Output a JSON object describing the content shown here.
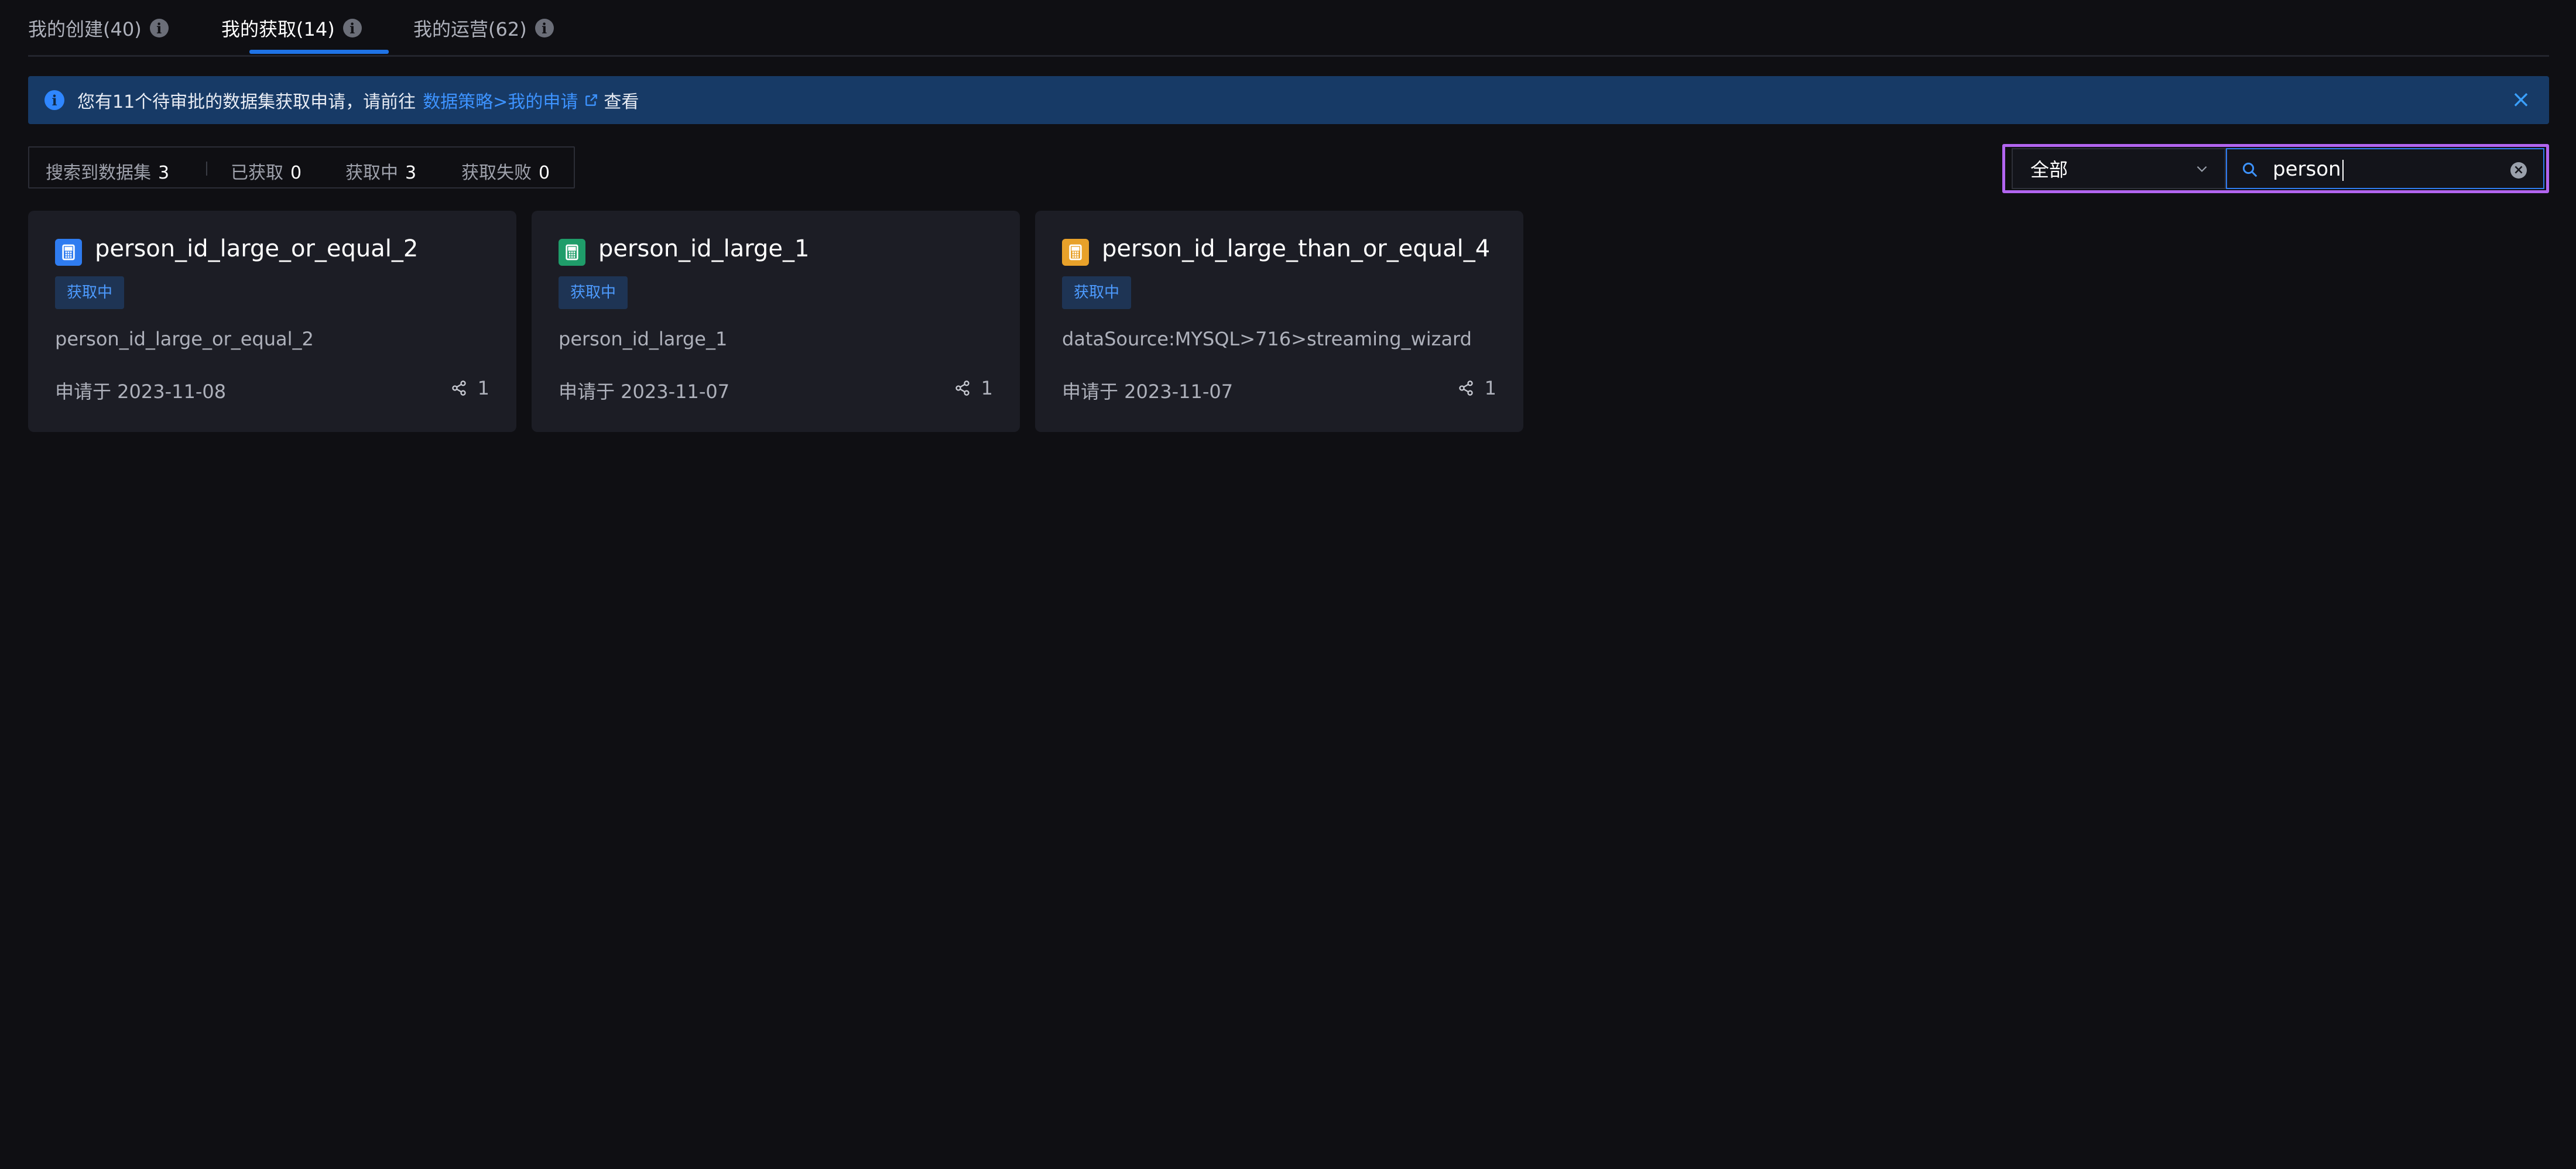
{
  "tabs": [
    {
      "label": "我的创建(40)"
    },
    {
      "label": "我的获取(14)"
    },
    {
      "label": "我的运营(62)"
    }
  ],
  "banner": {
    "message": "您有11个待审批的数据集获取申请，请前往",
    "link_text": "数据策略>我的申请",
    "suffix": "查看"
  },
  "stats": {
    "searched_label": "搜索到数据集",
    "searched_count": "3",
    "acquired_label": "已获取",
    "acquired_count": "0",
    "acquiring_label": "获取中",
    "acquiring_count": "3",
    "failed_label": "获取失败",
    "failed_count": "0"
  },
  "filter": {
    "select_value": "全部",
    "search_value": "person"
  },
  "cards": [
    {
      "title": "person_id_large_or_equal_2",
      "status": "获取中",
      "description": "person_id_large_or_equal_2",
      "date": "申请于 2023-11-08",
      "share_count": "1",
      "icon_color": "#2f7cf0"
    },
    {
      "title": "person_id_large_1",
      "status": "获取中",
      "description": "person_id_large_1",
      "date": "申请于 2023-11-07",
      "share_count": "1",
      "icon_color": "#1f9d6a"
    },
    {
      "title": "person_id_large_than_or_equal_4",
      "status": "获取中",
      "description": "dataSource:MYSQL>716>streaming_wizard",
      "date": "申请于 2023-11-07",
      "share_count": "1",
      "icon_color": "#e8a12a"
    }
  ],
  "colors": {
    "background": "#0f0f13",
    "accent": "#1f73e6",
    "highlight_outline": "#b265f0",
    "banner_bg": "#173a66",
    "card_bg": "#1c1d25"
  }
}
